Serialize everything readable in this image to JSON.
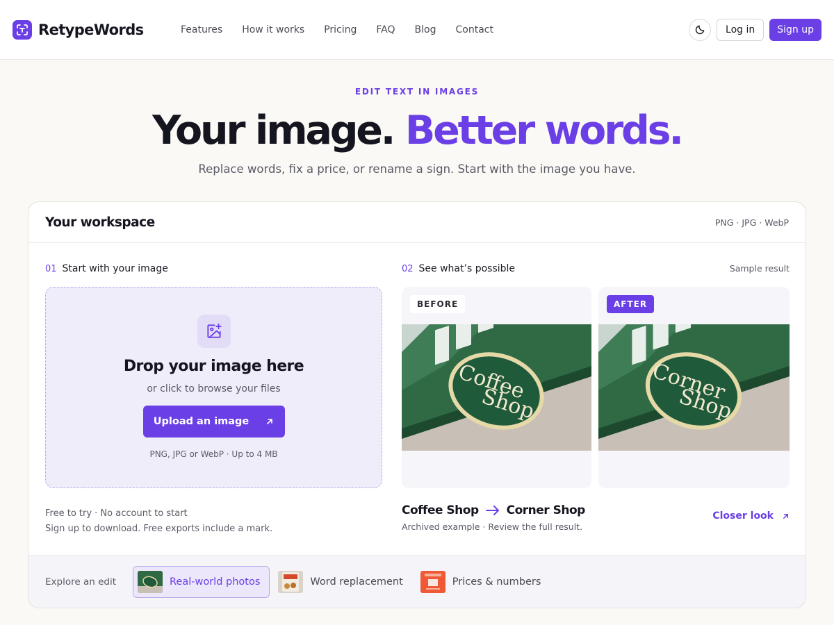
{
  "brand": {
    "name": "RetypeWords",
    "logo_icon": "scan-text-icon"
  },
  "nav": {
    "links": [
      "Features",
      "How it works",
      "Pricing",
      "FAQ",
      "Blog",
      "Contact"
    ],
    "theme_icon": "moon-icon",
    "login_label": "Log in",
    "signup_label": "Sign up"
  },
  "hero": {
    "eyebrow": "EDIT TEXT IN IMAGES",
    "headline_main": "Your image. ",
    "headline_accent": "Better words.",
    "subhead": "Replace words, fix a price, or rename a sign. Start with the image you have."
  },
  "workspace": {
    "title": "Your workspace",
    "formats": "PNG · JPG · WebP",
    "step1": {
      "num": "01",
      "label": "Start with your image"
    },
    "dropzone": {
      "icon": "image-plus-icon",
      "title": "Drop your image here",
      "subtitle": "or click to browse your files",
      "button_label": "Upload an image",
      "note": "PNG, JPG or WebP · Up to 4 MB"
    },
    "notes": [
      "Free to try · No account to start",
      "Sign up to download. Free exports include a mark."
    ],
    "step2": {
      "num": "02",
      "label": "See what’s possible"
    },
    "sample_label": "Sample result",
    "before": {
      "tag": "BEFORE",
      "line1": "Coffee",
      "line2": "Shop"
    },
    "after": {
      "tag": "AFTER",
      "line1": "Corner",
      "line2": "Shop"
    },
    "result": {
      "from": "Coffee Shop",
      "to": "Corner Shop",
      "sub": "Archived example · Review the full result.",
      "closer_label": "Closer look"
    },
    "explore": {
      "label": "Explore an edit",
      "chips": [
        "Real-world photos",
        "Word replacement",
        "Prices & numbers"
      ],
      "active_index": 0
    }
  },
  "colors": {
    "accent": "#6a3fe6",
    "sign_green": "#1f5a3a",
    "background": "#fbf9f5"
  }
}
